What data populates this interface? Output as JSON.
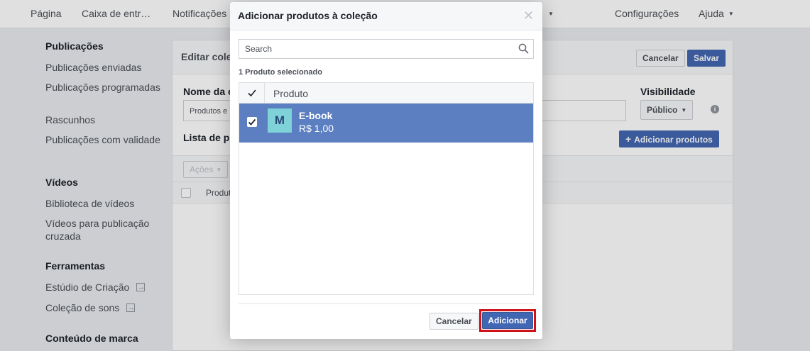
{
  "topnav": {
    "items": [
      "Página",
      "Caixa de entr…",
      "Notificações",
      "Configurações",
      "Ajuda"
    ]
  },
  "sidebar": {
    "sections": [
      {
        "title": "Publicações",
        "items": [
          "Publicações enviadas",
          "Publicações programadas",
          "Rascunhos",
          "Publicações com validade"
        ]
      },
      {
        "title": "Vídeos",
        "items": [
          "Biblioteca de vídeos",
          "Vídeos para publicação cruzada"
        ]
      },
      {
        "title": "Ferramentas",
        "items": [
          "Estúdio de Criação",
          "Coleção de sons"
        ]
      },
      {
        "title": "Conteúdo de marca"
      }
    ]
  },
  "main": {
    "title": "Editar cole",
    "cancel": "Cancelar",
    "save": "Salvar",
    "name_label": "Nome da c",
    "name_value": "Produtos e",
    "visibility_label": "Visibilidade",
    "visibility_value": "Público",
    "list_label": "Lista de p",
    "add_products": "Adicionar produtos",
    "actions": "Ações",
    "col_product": "Produt"
  },
  "modal": {
    "title": "Adicionar produtos à coleção",
    "search_placeholder": "Search",
    "selected_count": "1 Produto selecionado",
    "col_product": "Produto",
    "products": [
      {
        "thumb": "M",
        "name": "E-book",
        "price": "R$ 1,00",
        "selected": true
      }
    ],
    "cancel": "Cancelar",
    "add": "Adicionar"
  },
  "colors": {
    "brand_blue": "#4267b2",
    "row_selected": "#5b7fc1",
    "highlight": "#d0121b",
    "thumb_bg": "#7fd3d8"
  }
}
